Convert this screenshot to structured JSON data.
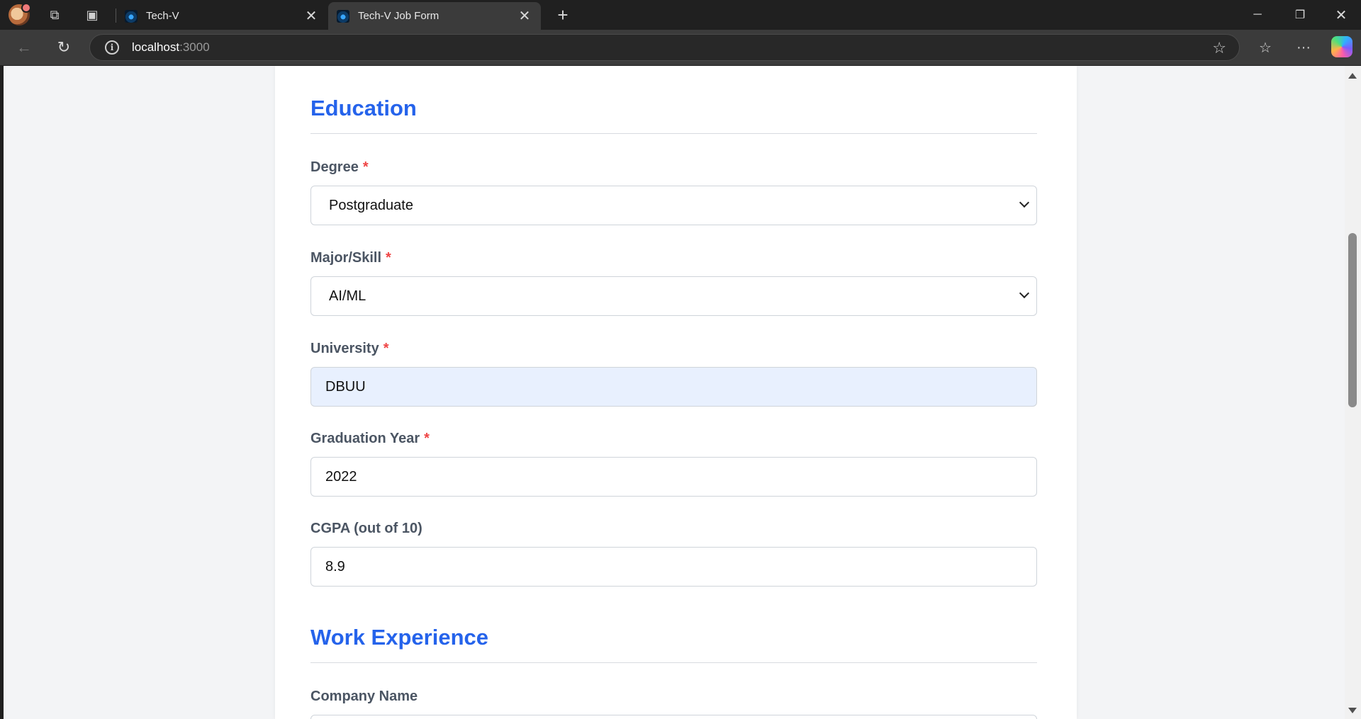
{
  "browser": {
    "tabs": [
      {
        "title": "Tech-V",
        "active": false
      },
      {
        "title": "Tech-V Job Form",
        "active": true
      }
    ],
    "url_host": "localhost",
    "url_port": ":3000",
    "icons": {
      "workspaces": "workspaces-icon",
      "vertical_tabs": "tab-actions-icon",
      "back": "back-arrow-icon",
      "refresh": "refresh-icon",
      "favorite": "star-icon",
      "favorites": "favorites-icon",
      "more": "more-icon"
    }
  },
  "form": {
    "education_title": "Education",
    "fields": {
      "degree": {
        "label": "Degree",
        "required": "*",
        "value": "Postgraduate"
      },
      "major": {
        "label": "Major/Skill",
        "required": "*",
        "value": "AI/ML"
      },
      "university": {
        "label": "University",
        "required": "*",
        "value": "DBUU"
      },
      "graduation_year": {
        "label": "Graduation Year",
        "required": "*",
        "value": "2022"
      },
      "cgpa": {
        "label": "CGPA (out of 10)",
        "value": "8.9"
      }
    },
    "work_title": "Work Experience",
    "company_label": "Company Name"
  },
  "colors": {
    "accent": "#2563eb",
    "required": "#ef4444",
    "autofill_bg": "#e8f0fe"
  }
}
